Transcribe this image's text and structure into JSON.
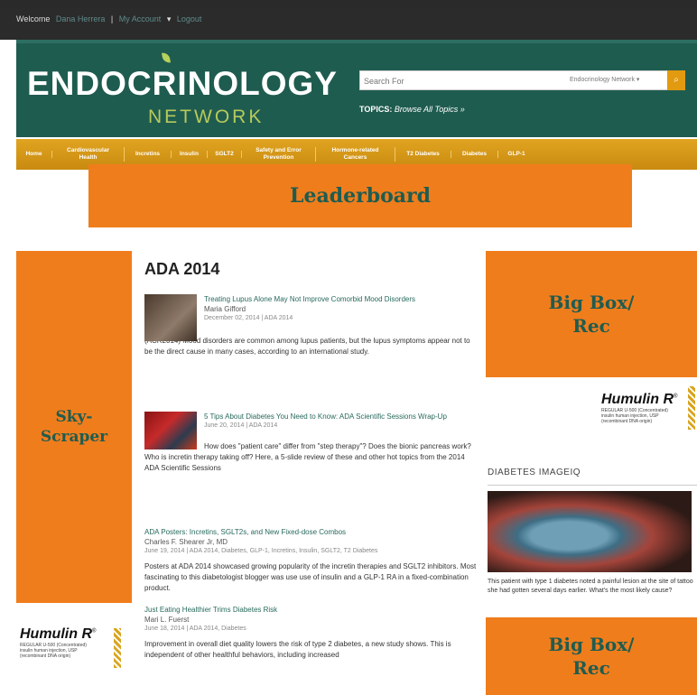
{
  "topbar": {
    "welcome": "Welcome",
    "user": "Dana Herrera",
    "my_account": "My Account",
    "logout": "Logout"
  },
  "header": {
    "logo_main": "ENDOCRINOLOGY",
    "logo_sub": "NETWORK",
    "search_placeholder": "Search For",
    "network_select": "Endocrinology Network ▾",
    "search_button_icon": "search-icon",
    "topics_label": "TOPICS:",
    "topics_link": "Browse All Topics »"
  },
  "nav": {
    "items": [
      "Home",
      "Cardiovascular Health",
      "Incretins",
      "Insulin",
      "SGLT2",
      "Safety and Error Prevention",
      "Hormone-related Cancers",
      "T2 Diabetes",
      "Diabetes",
      "GLP-1"
    ]
  },
  "ads": {
    "leaderboard": "Leaderboard",
    "skyscraper_line1": "Sky-",
    "skyscraper_line2": "Scraper",
    "bigbox_line1": "Big Box/",
    "bigbox_line2": "Rec"
  },
  "humulin": {
    "brand": "Humulin R",
    "reg": "®",
    "desc1": "REGULAR U-500 (Concentrated)",
    "desc2": "insulin human injection, USP",
    "desc3": "(recombinant DNA origin)"
  },
  "main": {
    "heading": "ADA 2014",
    "articles": [
      {
        "title": "Treating Lupus Alone May Not Improve Comorbid Mood Disorders",
        "author": "Maria Gifford",
        "meta": "December 02, 2014 | ADA 2014",
        "summary": "(ACR2014) Mood disorders are common among lupus patients, but the lupus symptoms appear not to be the direct cause in many cases, according to an international study."
      },
      {
        "title": "5 Tips About Diabetes You Need to Know: ADA Scientific Sessions Wrap-Up",
        "author": "",
        "meta": "June 20, 2014 | ADA 2014",
        "summary": "How does \"patient care\" differ from \"step therapy\"? Does the bionic pancreas work? Who is incretin therapy taking off? Here, a 5-slide review of these and other hot topics from the 2014 ADA Scientific Sessions"
      },
      {
        "title": "ADA Posters: Incretins, SGLT2s, and New Fixed-dose Combos",
        "author": "Charles F. Shearer Jr, MD",
        "meta": "June 19, 2014 | ADA 2014, Diabetes, GLP-1, Incretins, Insulin, SGLT2, T2 Diabetes",
        "summary": "Posters at ADA 2014 showcased growing popularity of the incretin therapies and SGLT2 inhibitors. Most fascinating to this diabetologist blogger was use use of insulin and a GLP-1 RA in a fixed-combination product."
      },
      {
        "title": "Just Eating Healthier Trims Diabetes Risk",
        "author": "Mari L. Fuerst",
        "meta": "June 18, 2014 | ADA 2014, Diabetes",
        "summary": "Improvement in overall diet quality lowers the risk of type 2 diabetes, a new study shows. This is independent of other healthful behaviors, including increased"
      }
    ]
  },
  "imageiq": {
    "heading": "DIABETES IMAGEIQ",
    "caption": "This patient with type 1 diabetes noted a painful lesion at the site of tattoo she had gotten several days earlier. What's the most likely cause?"
  }
}
